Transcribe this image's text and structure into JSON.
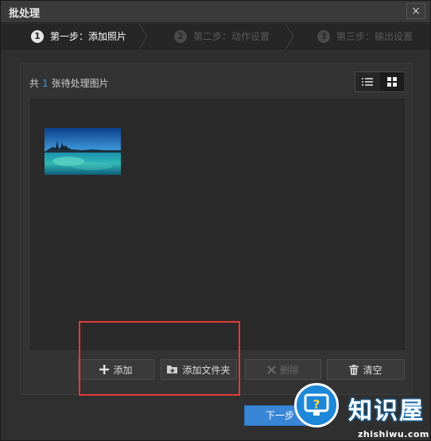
{
  "window": {
    "title": "批处理",
    "close_label": "×"
  },
  "steps": [
    {
      "number": "1",
      "label": "第一步：添加照片",
      "state": "active"
    },
    {
      "number": "2",
      "label": "第二步：动作设置",
      "state": "inactive"
    },
    {
      "number": "3",
      "label": "第三步：输出设置",
      "state": "inactive"
    }
  ],
  "panel": {
    "count_prefix": "共",
    "count": "1",
    "count_suffix": "张待处理图片",
    "view_modes": [
      {
        "name": "list",
        "icon": "list-view-icon",
        "selected": false
      },
      {
        "name": "grid",
        "icon": "grid-view-icon",
        "selected": true
      }
    ],
    "images": [
      {
        "icon": "lake-landscape-photo"
      }
    ]
  },
  "buttons": {
    "add": {
      "label": "添加",
      "icon": "plus-icon",
      "enabled": true
    },
    "add_folder": {
      "label": "添加文件夹",
      "icon": "add-folder-icon",
      "enabled": true
    },
    "delete": {
      "label": "删除",
      "icon": "x-icon",
      "enabled": false
    },
    "clear": {
      "label": "清空",
      "icon": "trash-icon",
      "enabled": true
    }
  },
  "footer": {
    "next_label": "下一步"
  },
  "watermark": {
    "brand": "知识屋",
    "url": "zhishiwu.com"
  },
  "colors": {
    "accent": "#3a86d6",
    "count_highlight": "#3b9ae8",
    "annotation_box": "#e53935",
    "watermark_blue": "#1d88d8"
  }
}
